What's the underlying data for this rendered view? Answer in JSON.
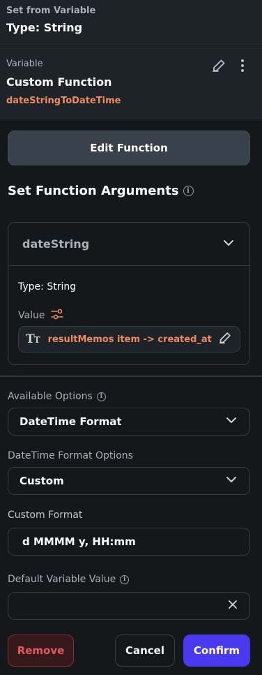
{
  "header": {
    "subtitle": "Set from Variable",
    "type_label": "Type: String"
  },
  "variable": {
    "label": "Variable",
    "name": "Custom Function",
    "function_id": "dateStringToDateTime"
  },
  "edit_function_label": "Edit Function",
  "arguments": {
    "title": "Set Function Arguments",
    "items": [
      {
        "name": "dateString",
        "type_label": "Type: String",
        "value_label": "Value",
        "value": "resultMemos item -> created_at"
      }
    ]
  },
  "available_options": {
    "label": "Available Options",
    "selected": "DateTime Format"
  },
  "datetime_format_options": {
    "label": "DateTime Format Options",
    "selected": "Custom"
  },
  "custom_format": {
    "label": "Custom Format",
    "value": "d MMMM y, HH:mm"
  },
  "default_value": {
    "label": "Default Variable Value",
    "value": ""
  },
  "footer": {
    "remove": "Remove",
    "cancel": "Cancel",
    "confirm": "Confirm"
  },
  "colors": {
    "accent": "#4b39ef",
    "orange": "#ee8b60",
    "danger": "#e25a5f"
  }
}
